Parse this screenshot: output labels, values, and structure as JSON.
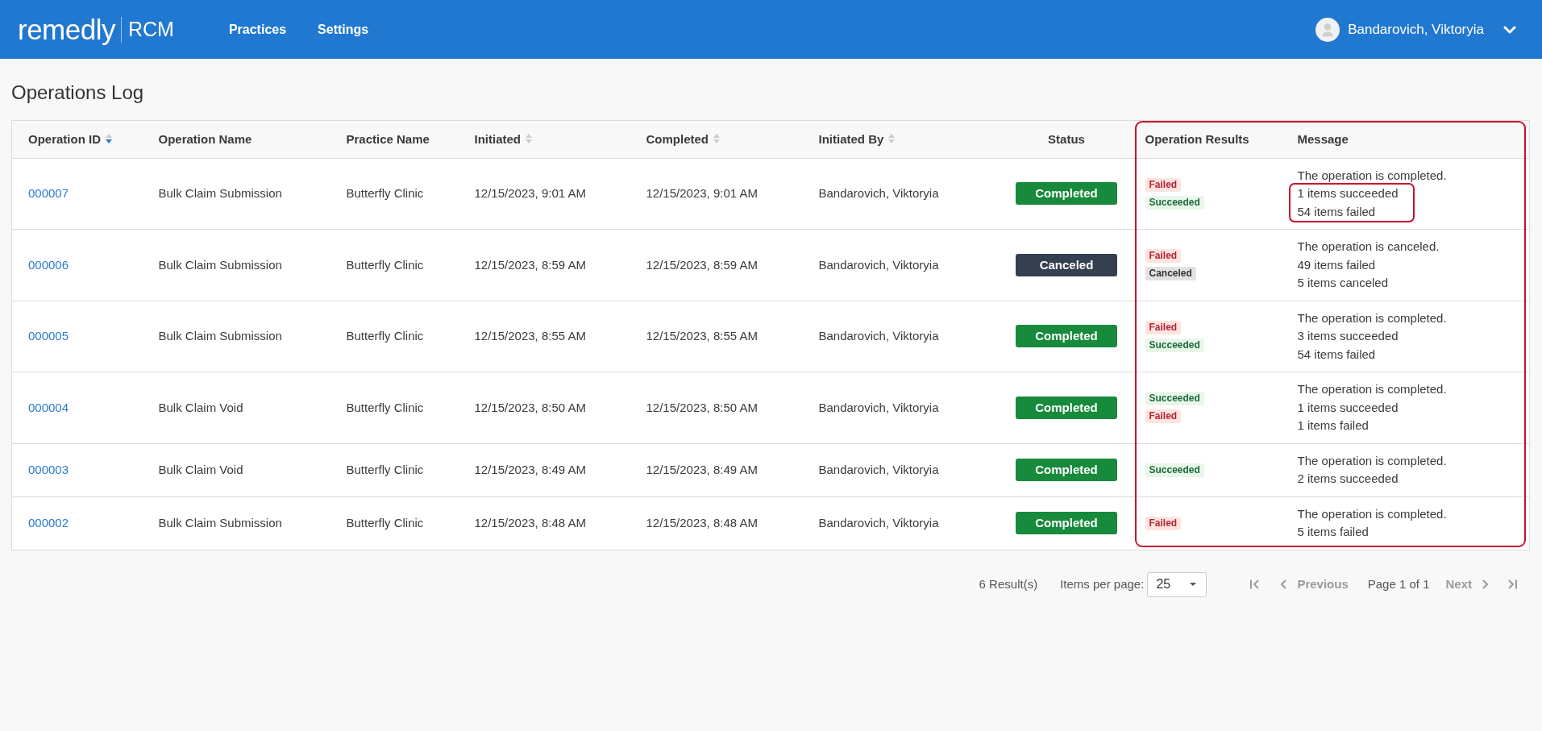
{
  "header": {
    "logo": {
      "wordmark": "remedly",
      "product": "RCM"
    },
    "nav": [
      "Practices",
      "Settings"
    ],
    "user": {
      "name": "Bandarovich, Viktoryia"
    }
  },
  "page_title": "Operations Log",
  "table": {
    "columns": [
      {
        "label": "Operation ID",
        "sortable": true,
        "sorted": true,
        "highlighted": false
      },
      {
        "label": "Operation Name",
        "sortable": false,
        "sorted": false,
        "highlighted": false
      },
      {
        "label": "Practice Name",
        "sortable": false,
        "sorted": false,
        "highlighted": false
      },
      {
        "label": "Initiated",
        "sortable": true,
        "sorted": false,
        "highlighted": false
      },
      {
        "label": "Completed",
        "sortable": true,
        "sorted": false,
        "highlighted": false
      },
      {
        "label": "Initiated By",
        "sortable": true,
        "sorted": false,
        "highlighted": false
      },
      {
        "label": "Status",
        "sortable": false,
        "sorted": false,
        "highlighted": false
      },
      {
        "label": "Operation Results",
        "sortable": false,
        "sorted": false,
        "highlighted": true
      },
      {
        "label": "Message",
        "sortable": false,
        "sorted": false,
        "highlighted": true
      }
    ],
    "rows": [
      {
        "id": "000007",
        "operation_name": "Bulk Claim Submission",
        "practice_name": "Butterfly Clinic",
        "initiated": "12/15/2023, 9:01 AM",
        "completed": "12/15/2023, 9:01 AM",
        "initiated_by": "Bandarovich, Viktoryia",
        "status": {
          "label": "Completed",
          "kind": "completed"
        },
        "results": [
          {
            "label": "Failed",
            "kind": "failed"
          },
          {
            "label": "Succeeded",
            "kind": "succeeded"
          }
        ],
        "message": [
          {
            "text": "The operation is completed.",
            "highlighted": false
          },
          {
            "text": "1 items succeeded",
            "highlighted": true
          },
          {
            "text": "54 items failed",
            "highlighted": true
          }
        ]
      },
      {
        "id": "000006",
        "operation_name": "Bulk Claim Submission",
        "practice_name": "Butterfly Clinic",
        "initiated": "12/15/2023, 8:59 AM",
        "completed": "12/15/2023, 8:59 AM",
        "initiated_by": "Bandarovich, Viktoryia",
        "status": {
          "label": "Canceled",
          "kind": "canceled"
        },
        "results": [
          {
            "label": "Failed",
            "kind": "failed"
          },
          {
            "label": "Canceled",
            "kind": "canceled"
          }
        ],
        "message": [
          {
            "text": "The operation is canceled.",
            "highlighted": false
          },
          {
            "text": "49 items failed",
            "highlighted": false
          },
          {
            "text": "5 items canceled",
            "highlighted": false
          }
        ]
      },
      {
        "id": "000005",
        "operation_name": "Bulk Claim Submission",
        "practice_name": "Butterfly Clinic",
        "initiated": "12/15/2023, 8:55 AM",
        "completed": "12/15/2023, 8:55 AM",
        "initiated_by": "Bandarovich, Viktoryia",
        "status": {
          "label": "Completed",
          "kind": "completed"
        },
        "results": [
          {
            "label": "Failed",
            "kind": "failed"
          },
          {
            "label": "Succeeded",
            "kind": "succeeded"
          }
        ],
        "message": [
          {
            "text": "The operation is completed.",
            "highlighted": false
          },
          {
            "text": "3 items succeeded",
            "highlighted": false
          },
          {
            "text": "54 items failed",
            "highlighted": false
          }
        ]
      },
      {
        "id": "000004",
        "operation_name": "Bulk Claim Void",
        "practice_name": "Butterfly Clinic",
        "initiated": "12/15/2023, 8:50 AM",
        "completed": "12/15/2023, 8:50 AM",
        "initiated_by": "Bandarovich, Viktoryia",
        "status": {
          "label": "Completed",
          "kind": "completed"
        },
        "results": [
          {
            "label": "Succeeded",
            "kind": "succeeded"
          },
          {
            "label": "Failed",
            "kind": "failed"
          }
        ],
        "message": [
          {
            "text": "The operation is completed.",
            "highlighted": false
          },
          {
            "text": "1 items succeeded",
            "highlighted": false
          },
          {
            "text": "1 items failed",
            "highlighted": false
          }
        ]
      },
      {
        "id": "000003",
        "operation_name": "Bulk Claim Void",
        "practice_name": "Butterfly Clinic",
        "initiated": "12/15/2023, 8:49 AM",
        "completed": "12/15/2023, 8:49 AM",
        "initiated_by": "Bandarovich, Viktoryia",
        "status": {
          "label": "Completed",
          "kind": "completed"
        },
        "results": [
          {
            "label": "Succeeded",
            "kind": "succeeded"
          }
        ],
        "message": [
          {
            "text": "The operation is completed.",
            "highlighted": false
          },
          {
            "text": "2 items succeeded",
            "highlighted": false
          }
        ]
      },
      {
        "id": "000002",
        "operation_name": "Bulk Claim Submission",
        "practice_name": "Butterfly Clinic",
        "initiated": "12/15/2023, 8:48 AM",
        "completed": "12/15/2023, 8:48 AM",
        "initiated_by": "Bandarovich, Viktoryia",
        "status": {
          "label": "Completed",
          "kind": "completed"
        },
        "results": [
          {
            "label": "Failed",
            "kind": "failed"
          }
        ],
        "message": [
          {
            "text": "The operation is completed.",
            "highlighted": false
          },
          {
            "text": "5 items failed",
            "highlighted": false
          }
        ]
      }
    ]
  },
  "pagination": {
    "results": "6 Result(s)",
    "per_page_label": "Items per page:",
    "per_page": "25",
    "first": {
      "disabled": true
    },
    "previous": {
      "label": "Previous",
      "disabled": true
    },
    "page_label": "Page 1 of 1",
    "next": {
      "label": "Next",
      "disabled": true
    },
    "last": {
      "disabled": true
    }
  }
}
